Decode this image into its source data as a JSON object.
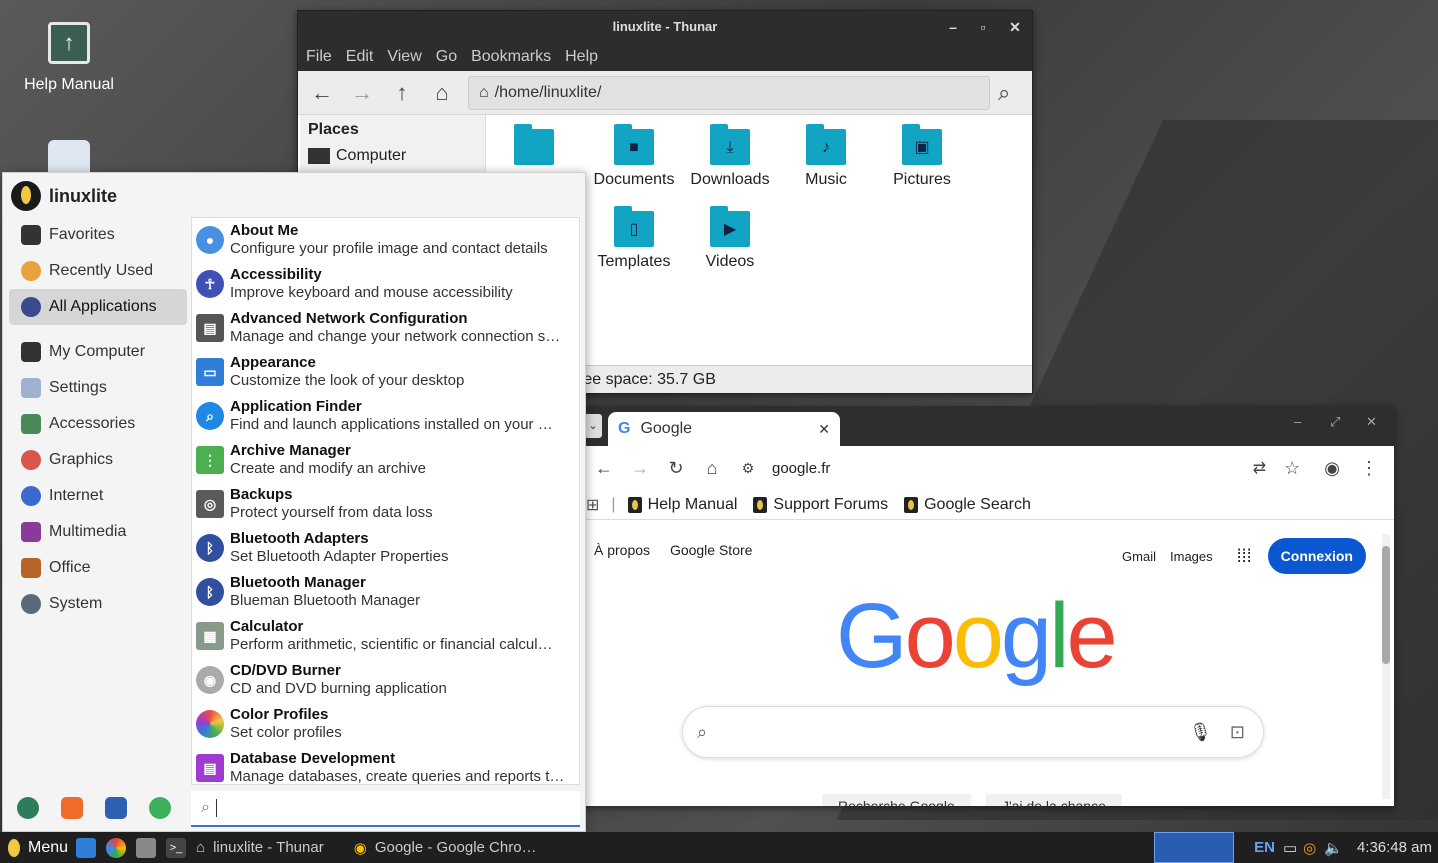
{
  "desktop": {
    "help_manual_label": "Help Manual"
  },
  "thunar": {
    "title": "linuxlite - Thunar",
    "menu": [
      "File",
      "Edit",
      "View",
      "Go",
      "Bookmarks",
      "Help"
    ],
    "path": "/home/linuxlite/",
    "places_heading": "Places",
    "places": [
      "Computer"
    ],
    "files": [
      "Documents",
      "Downloads",
      "Music",
      "Pictures",
      "Templates",
      "Videos"
    ],
    "status": "ree space: 35.7 GB"
  },
  "chrome": {
    "tab_title": "Google",
    "url": "google.fr",
    "bookmarks": [
      "Help Manual",
      "Support Forums",
      "Google Search"
    ],
    "top_left": [
      "À propos",
      "Google Store"
    ],
    "top_right": [
      "Gmail",
      "Images"
    ],
    "signin": "Connexion",
    "logo": "Google",
    "buttons": [
      "Recherche Google",
      "J'ai de la chance"
    ]
  },
  "menu": {
    "user": "linuxlite",
    "categories": [
      {
        "label": "Favorites",
        "color": "#333333"
      },
      {
        "label": "Recently Used",
        "color": "#e8a33a"
      },
      {
        "label": "All Applications",
        "color": "#3a4a8a"
      },
      {
        "label": "My Computer",
        "color": "#333333"
      },
      {
        "label": "Settings",
        "color": "#9fb1cc"
      },
      {
        "label": "Accessories",
        "color": "#4a8a5a"
      },
      {
        "label": "Graphics",
        "color": "#d8574a"
      },
      {
        "label": "Internet",
        "color": "#3a6ad0"
      },
      {
        "label": "Multimedia",
        "color": "#8a3a9a"
      },
      {
        "label": "Office",
        "color": "#b8652a"
      },
      {
        "label": "System",
        "color": "#5a6a7a"
      }
    ],
    "apps": [
      {
        "name": "About Me",
        "desc": "Configure your profile image and contact details",
        "color": "#4a90e2",
        "icon": "person-icon"
      },
      {
        "name": "Accessibility",
        "desc": "Improve keyboard and mouse accessibility",
        "color": "#3f51b5",
        "icon": "accessibility-icon"
      },
      {
        "name": "Advanced Network Configuration",
        "desc": "Manage and change your network connection s…",
        "color": "#555555",
        "icon": "network-icon"
      },
      {
        "name": "Appearance",
        "desc": "Customize the look of your desktop",
        "color": "#2f7fd8",
        "icon": "appearance-icon"
      },
      {
        "name": "Application Finder",
        "desc": "Find and launch applications installed on your …",
        "color": "#1e88e5",
        "icon": "search-icon"
      },
      {
        "name": "Archive Manager",
        "desc": "Create and modify an archive",
        "color": "#4caf50",
        "icon": "archive-icon"
      },
      {
        "name": "Backups",
        "desc": "Protect yourself from data loss",
        "color": "#5a5a5a",
        "icon": "backup-icon"
      },
      {
        "name": "Bluetooth Adapters",
        "desc": "Set Bluetooth Adapter Properties",
        "color": "#2f4f9f",
        "icon": "bluetooth-icon"
      },
      {
        "name": "Bluetooth Manager",
        "desc": "Blueman Bluetooth Manager",
        "color": "#2f4f9f",
        "icon": "bluetooth-icon"
      },
      {
        "name": "Calculator",
        "desc": "Perform arithmetic, scientific or financial calcul…",
        "color": "#8a9a8a",
        "icon": "calculator-icon"
      },
      {
        "name": "CD/DVD Burner",
        "desc": "CD and DVD burning application",
        "color": "#aaaaaa",
        "icon": "disc-icon"
      },
      {
        "name": "Color Profiles",
        "desc": "Set color profiles",
        "color": "#e84a8a",
        "icon": "color-icon"
      },
      {
        "name": "Database Development",
        "desc": "Manage databases, create queries and reports t…",
        "color": "#a03ad0",
        "icon": "database-icon"
      }
    ],
    "search_placeholder": ""
  },
  "taskbar": {
    "menu_label": "Menu",
    "tasks": [
      "linuxlite - Thunar",
      "Google - Google Chro…"
    ],
    "lang": "EN",
    "clock": "4:36:48 am"
  }
}
